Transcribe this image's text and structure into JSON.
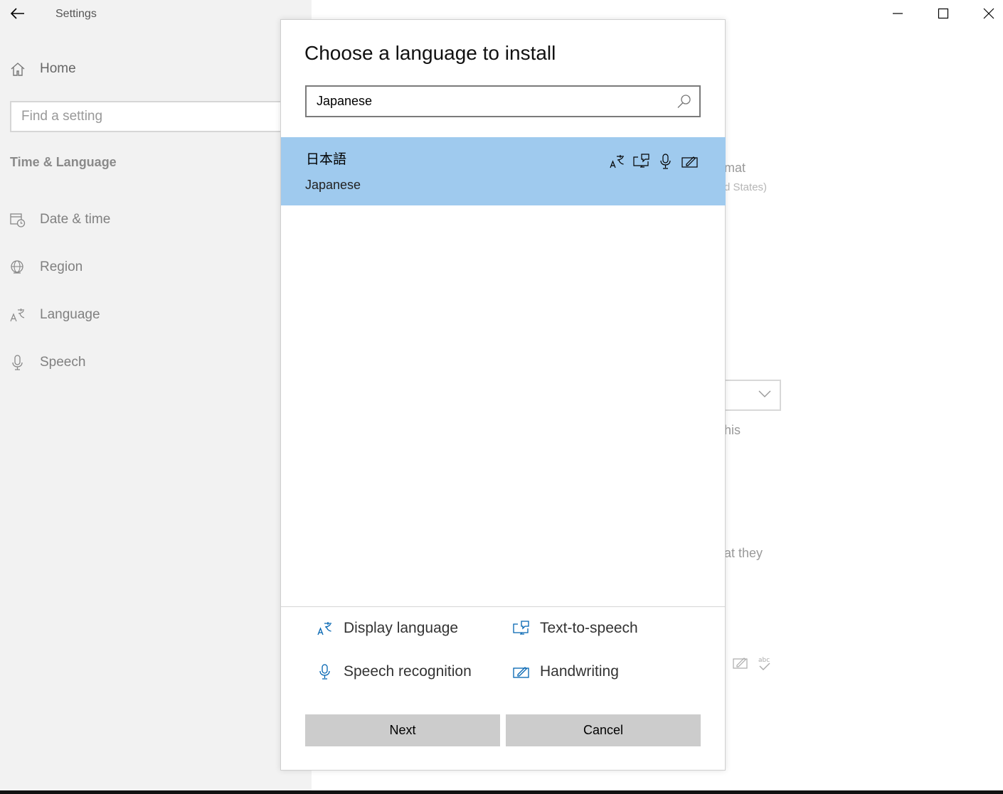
{
  "app": {
    "title": "Settings"
  },
  "sidebar": {
    "home_label": "Home",
    "search_placeholder": "Find a setting",
    "section_title": "Time & Language",
    "items": [
      {
        "label": "Date & time",
        "icon": "calendar-clock-icon"
      },
      {
        "label": "Region",
        "icon": "globe-icon"
      },
      {
        "label": "Language",
        "icon": "language-icon"
      },
      {
        "label": "Speech",
        "icon": "microphone-icon"
      }
    ]
  },
  "background": {
    "frag_format": "mat",
    "frag_states": "d States)",
    "frag_this": "his",
    "frag_they": "at they"
  },
  "dialog": {
    "title": "Choose a language to install",
    "search_value": "Japanese",
    "result": {
      "native_name": "日本語",
      "english_name": "Japanese",
      "features": [
        "display-language-icon",
        "text-to-speech-icon",
        "speech-recognition-icon",
        "handwriting-icon"
      ]
    },
    "legend": {
      "display_language": "Display language",
      "text_to_speech": "Text-to-speech",
      "speech_recognition": "Speech recognition",
      "handwriting": "Handwriting"
    },
    "next_label": "Next",
    "cancel_label": "Cancel"
  },
  "colors": {
    "selected_row": "#9fcaee",
    "accent_icon": "#0063b1",
    "button_bg": "#cccccc"
  }
}
